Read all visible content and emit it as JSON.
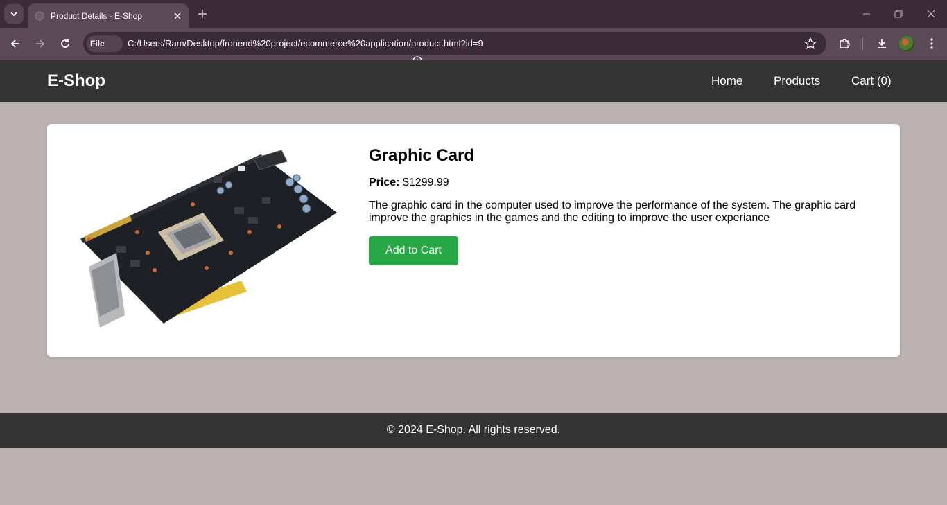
{
  "browser": {
    "tab_title": "Product Details - E-Shop",
    "site_chip": "File",
    "url": "C:/Users/Ram/Desktop/fronend%20project/ecommerce%20application/product.html?id=9",
    "icons": [
      "tab-search-icon",
      "globe-icon",
      "close-icon",
      "plus-icon",
      "minimize-icon",
      "restore-icon",
      "back-icon",
      "forward-icon",
      "reload-icon",
      "info-icon",
      "star-icon",
      "extensions-icon",
      "download-icon",
      "avatar",
      "more-icon"
    ]
  },
  "header": {
    "logo": "E-Shop",
    "nav": {
      "home": "Home",
      "products": "Products",
      "cart": "Cart (0)"
    }
  },
  "product": {
    "title": "Graphic Card",
    "price_label": "Price:",
    "price": "$1299.99",
    "description": "The graphic card in the computer used to improve the performance of the system. The graphic card improve the graphics in the games and the editing to improve the user experiance",
    "add_to_cart_label": "Add to Cart"
  },
  "footer": {
    "text": "© 2024 E-Shop. All rights reserved."
  },
  "colors": {
    "header_bg": "#333333",
    "page_bg": "#bab1b0",
    "button_green": "#28a745",
    "browser_frame": "#3c2c39",
    "browser_toolbar": "#5b4a56"
  }
}
